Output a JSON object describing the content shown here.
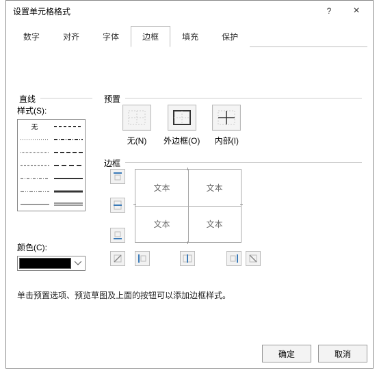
{
  "window": {
    "title": "设置单元格格式",
    "help_icon": "?",
    "close_icon": "×"
  },
  "tabs": [
    {
      "label": "数字"
    },
    {
      "label": "对齐"
    },
    {
      "label": "字体"
    },
    {
      "label": "边框",
      "active": true
    },
    {
      "label": "填充"
    },
    {
      "label": "保护"
    }
  ],
  "line_section": {
    "legend": "直线",
    "style_label": "样式(S):",
    "none_label": "无",
    "color_label": "颜色(C):",
    "color_value": "#000000"
  },
  "preset_section": {
    "legend": "预置",
    "buttons": [
      {
        "label": "无(N)",
        "key": "N"
      },
      {
        "label": "外边框(O)",
        "key": "O"
      },
      {
        "label": "内部(I)",
        "key": "I"
      }
    ]
  },
  "border_section": {
    "legend": "边框",
    "cell_text": "文本"
  },
  "help_text": "单击预置选项、预览草图及上面的按钮可以添加边框样式。",
  "footer": {
    "ok": "确定",
    "cancel": "取消"
  }
}
